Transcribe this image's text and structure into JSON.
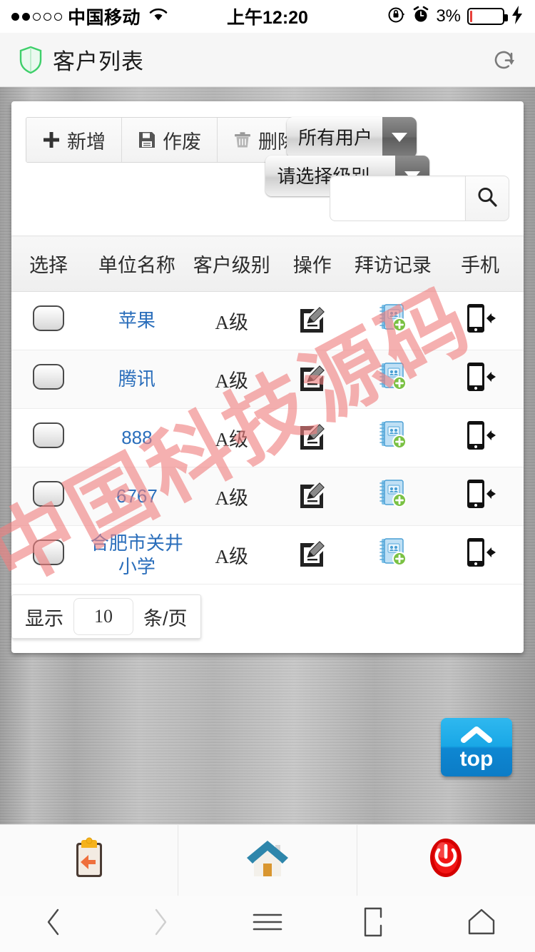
{
  "status_bar": {
    "carrier": "中国移动",
    "signal_dots_total": 5,
    "signal_dots_filled": 2,
    "wifi_icon": "wifi-icon",
    "time": "上午12:20",
    "lock_icon": "rotation-lock-icon",
    "alarm_icon": "alarm-clock-icon",
    "battery_percent": "3%",
    "battery_level": 3,
    "charging_icon": "lightning-bolt-icon"
  },
  "app_header": {
    "logo_icon": "shield-icon",
    "logo_color": "#3ecf6a",
    "title": "客户列表",
    "refresh_icon": "refresh-icon"
  },
  "toolbar": {
    "buttons": [
      {
        "icon": "plus-icon",
        "label": "新增"
      },
      {
        "icon": "save-floppy-icon",
        "label": "作废"
      },
      {
        "icon": "trash-icon",
        "label": "删除"
      }
    ],
    "user_select": {
      "value": "所有用户",
      "arrow_icon": "chevron-down-icon"
    },
    "level_select": {
      "value": "请选择级别...",
      "arrow_icon": "chevron-down-icon"
    },
    "search": {
      "value": "",
      "placeholder": "",
      "button_icon": "search-icon"
    }
  },
  "table": {
    "headers": [
      "选择",
      "单位名称",
      "客户级别",
      "操作",
      "拜访记录",
      "手机"
    ],
    "rows": [
      {
        "checked": false,
        "name": "苹果",
        "level": "A级",
        "edit_icon": "edit-pencil-icon",
        "visit_icon": "add-notebook-icon",
        "phone_icon": "mobile-phone-icon"
      },
      {
        "checked": false,
        "name": "腾讯",
        "level": "A级",
        "edit_icon": "edit-pencil-icon",
        "visit_icon": "add-notebook-icon",
        "phone_icon": "mobile-phone-icon"
      },
      {
        "checked": false,
        "name": "888",
        "level": "A级",
        "edit_icon": "edit-pencil-icon",
        "visit_icon": "add-notebook-icon",
        "phone_icon": "mobile-phone-icon"
      },
      {
        "checked": false,
        "name": "6767",
        "level": "A级",
        "edit_icon": "edit-pencil-icon",
        "visit_icon": "add-notebook-icon",
        "phone_icon": "mobile-phone-icon"
      },
      {
        "checked": false,
        "name": "合肥市关井小学",
        "level": "A级",
        "edit_icon": "edit-pencil-icon",
        "visit_icon": "add-notebook-icon",
        "phone_icon": "mobile-phone-icon"
      }
    ]
  },
  "pagination": {
    "prefix_label": "显示",
    "page_size": "10",
    "suffix_label": "条/页"
  },
  "watermark": {
    "text": "中国科技源码",
    "color": "#f08080"
  },
  "scroll_top_button": {
    "icon": "chevron-up-icon",
    "label": "top",
    "color": "#19a7e6"
  },
  "bottom_toolbar": {
    "items": [
      {
        "icon": "clipboard-back-icon",
        "name": "back-to-list"
      },
      {
        "icon": "home-house-icon",
        "name": "home"
      },
      {
        "icon": "power-off-icon",
        "name": "logout"
      }
    ]
  },
  "android_nav": {
    "items": [
      {
        "icon": "chevron-left-icon",
        "name": "nav-back"
      },
      {
        "icon": "chevron-right-icon",
        "name": "nav-forward"
      },
      {
        "icon": "hamburger-menu-icon",
        "name": "nav-menu"
      },
      {
        "icon": "tabs-icon",
        "name": "nav-tabs"
      },
      {
        "icon": "home-outline-icon",
        "name": "nav-home"
      }
    ]
  }
}
